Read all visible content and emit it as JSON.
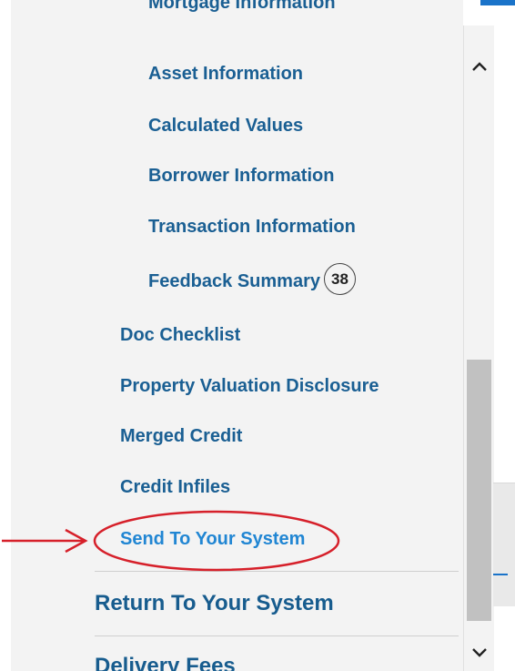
{
  "nav": {
    "sub_items": [
      {
        "label": "Mortgage Information"
      },
      {
        "label": "Asset Information"
      },
      {
        "label": "Calculated Values"
      },
      {
        "label": "Borrower Information"
      },
      {
        "label": "Transaction Information"
      },
      {
        "label": "Feedback Summary"
      }
    ],
    "feedback_count": "38",
    "items": [
      {
        "label": "Doc Checklist"
      },
      {
        "label": "Property Valuation Disclosure"
      },
      {
        "label": "Merged Credit"
      },
      {
        "label": "Credit Infiles"
      },
      {
        "label": "Send To Your System"
      }
    ],
    "top_items": [
      {
        "label": "Return To Your System"
      },
      {
        "label": "Delivery Fees"
      }
    ]
  },
  "colors": {
    "link": "#1a5f93",
    "highlighted_link": "#2186d3",
    "annotation_red": "#d6202a"
  },
  "annotation": {
    "target": "Send To Your System",
    "marker": "red-ellipse-with-arrow"
  }
}
